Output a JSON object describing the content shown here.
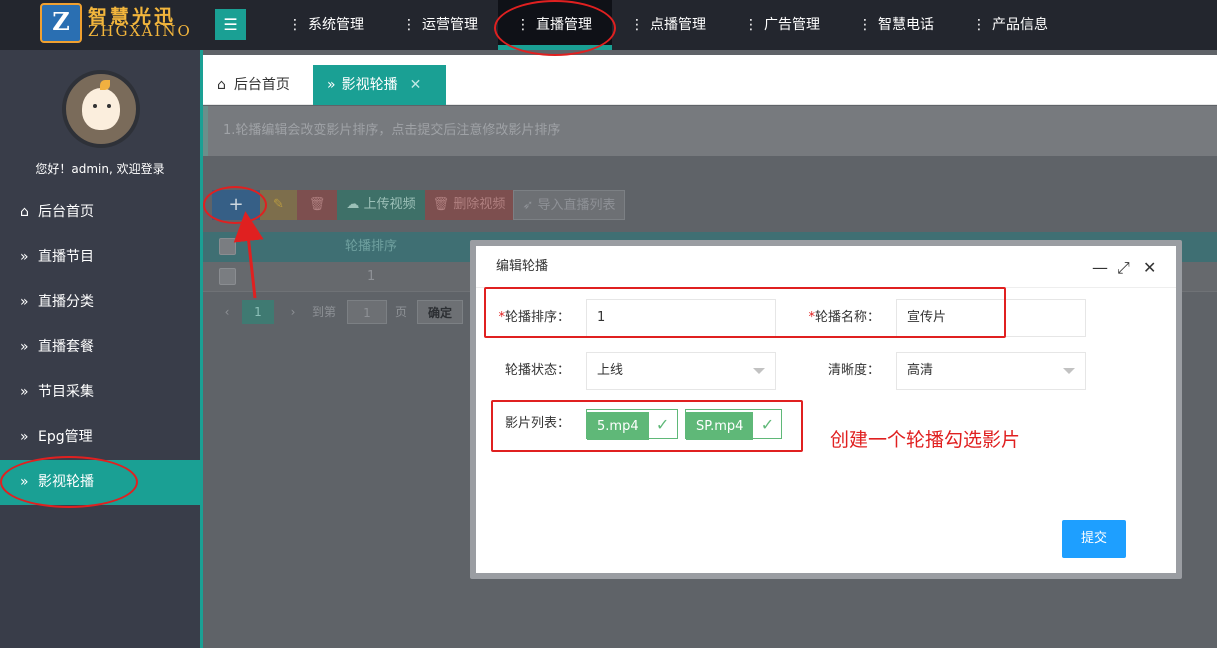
{
  "logo": {
    "mark": "Z",
    "cn": "智慧光迅",
    "en": "ZHGXAINO"
  },
  "topnav": [
    {
      "label": "系统管理"
    },
    {
      "label": "运营管理"
    },
    {
      "label": "直播管理"
    },
    {
      "label": "点播管理"
    },
    {
      "label": "广告管理"
    },
    {
      "label": "智慧电话"
    },
    {
      "label": "产品信息"
    }
  ],
  "topnav_active": "直播管理",
  "sidebar": {
    "greeting": "您好！admin, 欢迎登录",
    "items": [
      {
        "label": "后台首页",
        "icon": "home-icon"
      },
      {
        "label": "直播节目",
        "icon": "double-chevron-icon"
      },
      {
        "label": "直播分类",
        "icon": "double-chevron-icon"
      },
      {
        "label": "直播套餐",
        "icon": "double-chevron-icon"
      },
      {
        "label": "节目采集",
        "icon": "double-chevron-icon"
      },
      {
        "label": "Epg管理",
        "icon": "double-chevron-icon"
      },
      {
        "label": "影视轮播",
        "icon": "double-chevron-icon"
      }
    ],
    "active": "影视轮播"
  },
  "tabs": {
    "home": "后台首页",
    "active": "影视轮播"
  },
  "tip": "1.轮播编辑会改变影片排序，点击提交后注意修改影片排序",
  "toolbar": {
    "add": "+",
    "upload": "上传视频",
    "delete_video": "删除视频",
    "import": "导入直播列表"
  },
  "table": {
    "header": "轮播排序",
    "row_value": "1"
  },
  "pager": {
    "current": "1",
    "goto": "到第",
    "input": "1",
    "page_unit": "页",
    "ok": "确定"
  },
  "dialog": {
    "title": "编辑轮播",
    "fields": {
      "order_label": "轮播排序：",
      "order_value": "1",
      "name_label": "轮播名称：",
      "name_value": "宣传片",
      "status_label": "轮播状态：",
      "status_value": "上线",
      "quality_label": "清晰度：",
      "quality_value": "高清",
      "films_label": "影片列表："
    },
    "films": [
      "5.mp4",
      "SP.mp4"
    ],
    "submit": "提交"
  },
  "annotation": "创建一个轮播勾选影片",
  "colors": {
    "accent": "#1aa094",
    "topbar": "#23262e",
    "sidebar": "#393d49",
    "submit": "#1e9fff",
    "annotation": "#e02020",
    "chip": "#5fb878"
  }
}
